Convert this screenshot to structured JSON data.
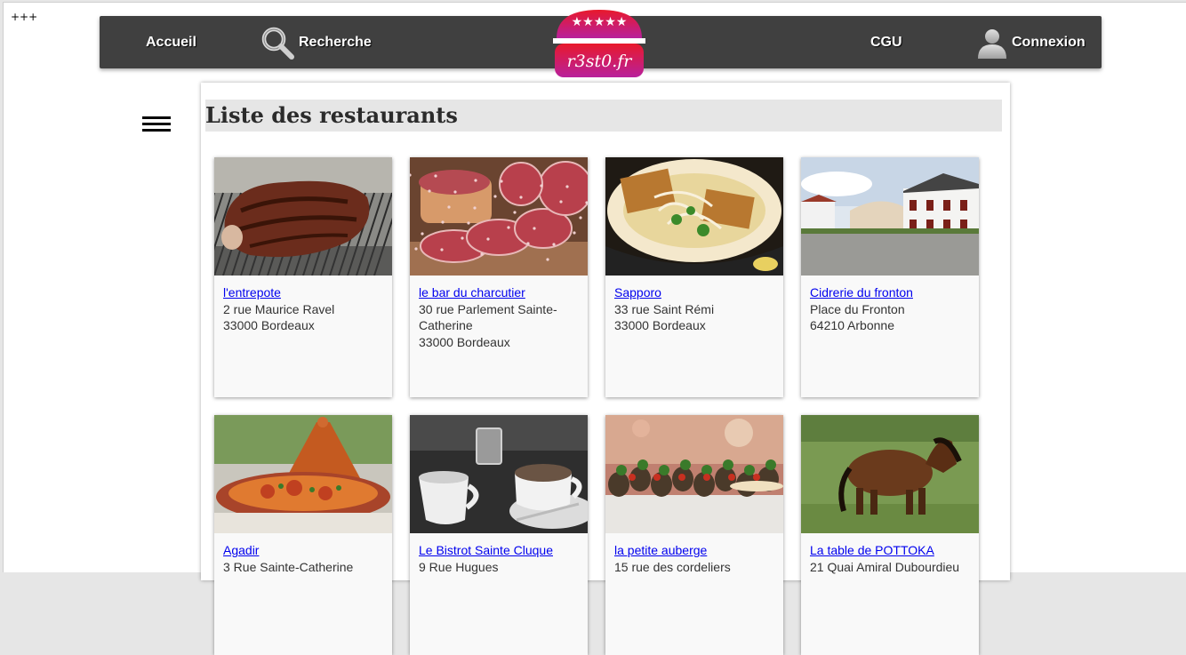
{
  "corner_text": "+++",
  "nav": {
    "home": "Accueil",
    "search": "Recherche",
    "cgu": "CGU",
    "login": "Connexion",
    "logo_text": "r3st0.fr",
    "logo_stars": 5
  },
  "page_title": "Liste des restaurants",
  "restaurants": [
    {
      "name": "l'entrepote",
      "address1": "2 rue Maurice Ravel",
      "address2": "33000 Bordeaux",
      "photo": "grilled-steak-photo"
    },
    {
      "name": "le bar du charcutier",
      "address1": "30 rue Parlement Sainte-Catherine",
      "address2": "33000 Bordeaux",
      "photo": "charcuterie-photo"
    },
    {
      "name": "Sapporo",
      "address1": "33 rue Saint Rémi",
      "address2": "33000 Bordeaux",
      "photo": "ramen-bowl-photo"
    },
    {
      "name": "Cidrerie du fronton",
      "address1": "Place du Fronton",
      "address2": "64210 Arbonne",
      "photo": "fronton-village-photo"
    },
    {
      "name": "Agadir",
      "address1": "3 Rue Sainte-Catherine",
      "address2": "",
      "photo": "tajine-photo"
    },
    {
      "name": "Le Bistrot Sainte Cluque",
      "address1": "9 Rue Hugues",
      "address2": "",
      "photo": "coffee-cups-photo"
    },
    {
      "name": "la petite auberge",
      "address1": "15 rue des cordeliers",
      "address2": "",
      "photo": "tapas-photo"
    },
    {
      "name": "La table de POTTOKA",
      "address1": "21 Quai Amiral Dubourdieu",
      "address2": "",
      "photo": "pottok-pony-photo"
    }
  ],
  "colors": {
    "navbar": "#404040",
    "logo_top": "#e0182d",
    "logo_bottom": "#b0249a",
    "link": "#0000ee",
    "title_band": "#e6e6e6"
  }
}
